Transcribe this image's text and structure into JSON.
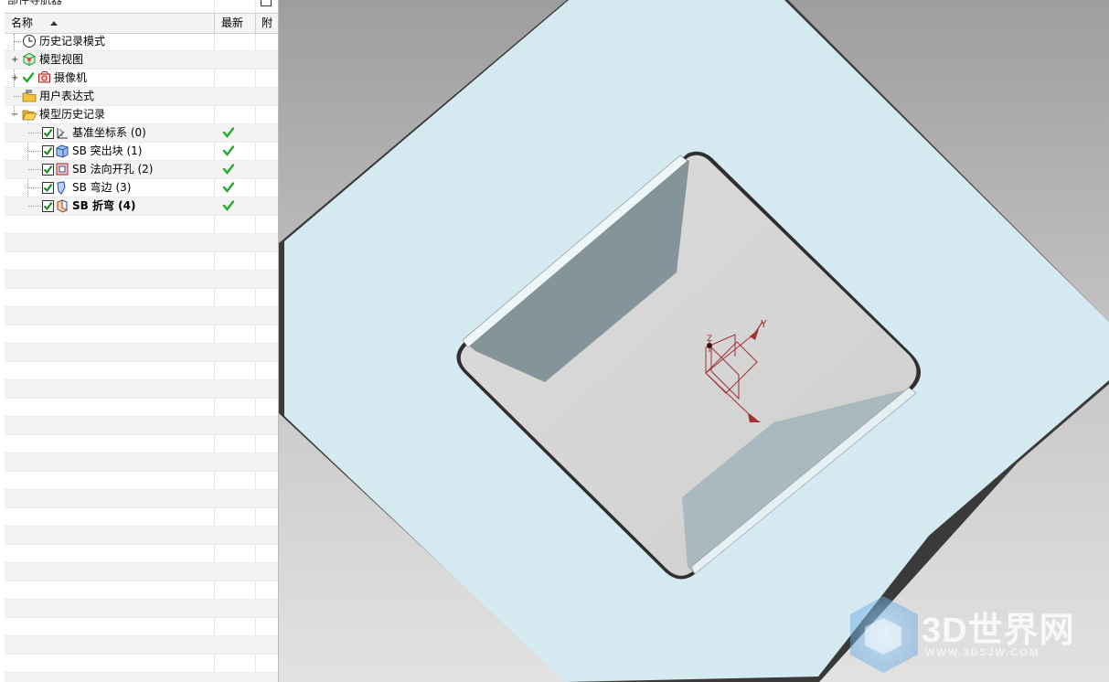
{
  "navigator": {
    "title": "部件导航器",
    "columns": {
      "name": "名称",
      "latest": "最新",
      "attach": "附"
    },
    "nodes": [
      {
        "label": "历史记录模式",
        "icon": "clock-icon"
      },
      {
        "label": "模型视图",
        "icon": "model-view-icon"
      },
      {
        "label": "摄像机",
        "icon": "camera-icon"
      },
      {
        "label": "用户表达式",
        "icon": "folder-expression-icon"
      },
      {
        "label": "模型历史记录",
        "icon": "folder-open-icon"
      },
      {
        "label": "基准坐标系 (0)",
        "icon": "datum-csys-icon",
        "latest": "✔"
      },
      {
        "label": "SB 突出块 (1)",
        "icon": "tab-icon",
        "latest": "✔"
      },
      {
        "label": "SB 法向开孔 (2)",
        "icon": "normal-cutout-icon",
        "latest": "✔"
      },
      {
        "label": "SB 弯边 (3)",
        "icon": "flange-icon",
        "latest": "✔"
      },
      {
        "label": "SB 折弯 (4)",
        "icon": "bend-icon",
        "latest": "✔"
      }
    ]
  },
  "viewport": {
    "csys_labels": {
      "y": "Y",
      "z": "Z"
    },
    "colors": {
      "plate": "#d5eaf0",
      "background": "#c4c4c4",
      "flange_dark": "#849498",
      "flange_light": "#a9b9bf"
    }
  },
  "watermark": {
    "text": "3D世界网",
    "url": "WWW.3DSJW.COM"
  }
}
